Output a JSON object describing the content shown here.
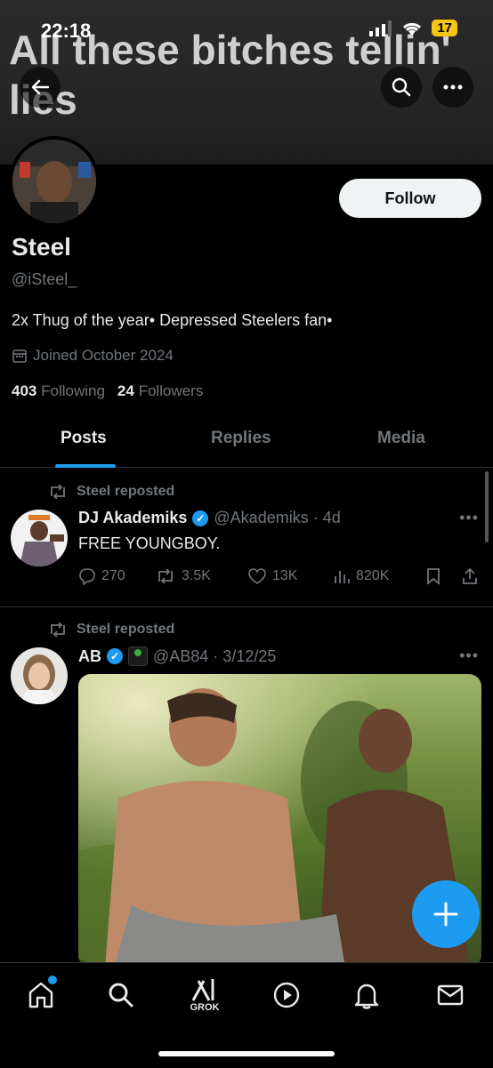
{
  "status_bar": {
    "time": "22:18",
    "battery": "17"
  },
  "banner": {
    "text": "All these bitches tellin' lies"
  },
  "profile": {
    "name": "Steel",
    "handle": "@iSteel_",
    "bio": "2x Thug of the year• Depressed Steelers fan•",
    "joined": "Joined October 2024",
    "following_count": "403",
    "following_label": "Following",
    "followers_count": "24",
    "followers_label": "Followers",
    "follow_label": "Follow"
  },
  "tabs": [
    {
      "label": "Posts"
    },
    {
      "label": "Replies"
    },
    {
      "label": "Media"
    }
  ],
  "posts": [
    {
      "repost_label": "Steel reposted",
      "author": "DJ Akademiks",
      "meta": "@Akademiks · 4d",
      "text": "FREE YOUNGBOY.",
      "replies": "270",
      "reposts": "3.5K",
      "likes": "13K",
      "views": "820K"
    },
    {
      "repost_label": "Steel reposted",
      "author": "AB",
      "meta": "@AB84 · 3/12/25"
    }
  ],
  "nav": {
    "grok_label": "GROK"
  },
  "colors": {
    "accent": "#1d9bf0",
    "background": "#000000",
    "muted": "#71767b"
  }
}
